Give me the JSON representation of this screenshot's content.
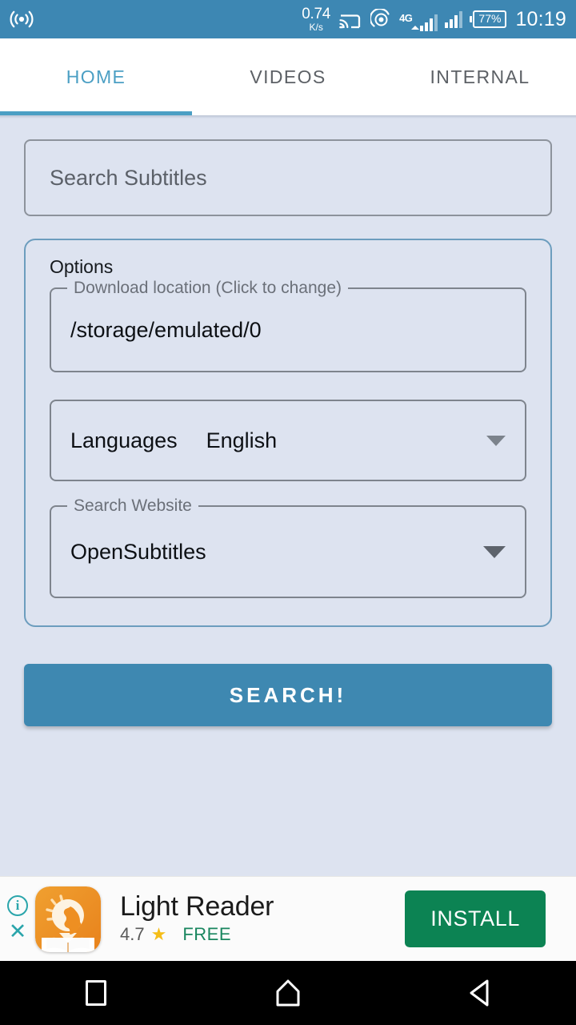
{
  "status_bar": {
    "hotspot_icon": "broadcast-hotspot-icon",
    "net_speed_value": "0.74",
    "net_speed_unit": "K/s",
    "cast_icon": "cast-screen-icon",
    "location_icon": "wifi-scan-icon",
    "network_type": "4G",
    "battery_level": "77%",
    "clock": "10:19",
    "background_color": "#3d87b3"
  },
  "tabs": [
    {
      "label": "HOME",
      "active": true
    },
    {
      "label": "VIDEOS",
      "active": false
    },
    {
      "label": "INTERNAL",
      "active": false
    }
  ],
  "tab_accent_color": "#4b9fc4",
  "search": {
    "placeholder": "Search Subtitles",
    "value": ""
  },
  "options": {
    "title": "Options",
    "download_location": {
      "legend": "Download location (Click to change)",
      "value": "/storage/emulated/0"
    },
    "languages": {
      "label": "Languages",
      "value": "English"
    },
    "search_website": {
      "legend": "Search Website",
      "value": "OpenSubtitles"
    }
  },
  "search_button": {
    "label": "SEARCH!",
    "color": "#3e88b1"
  },
  "ad": {
    "info_icon": "info-icon",
    "close_icon": "✕",
    "app_icon": "light-reader-app-icon",
    "title": "Light Reader",
    "rating": "4.7",
    "star": "★",
    "price": "FREE",
    "install_label": "INSTALL",
    "install_color": "#0c8353"
  },
  "nav_bar": {
    "recents": "recents-square-icon",
    "home": "home-icon",
    "back": "back-triangle-icon"
  }
}
